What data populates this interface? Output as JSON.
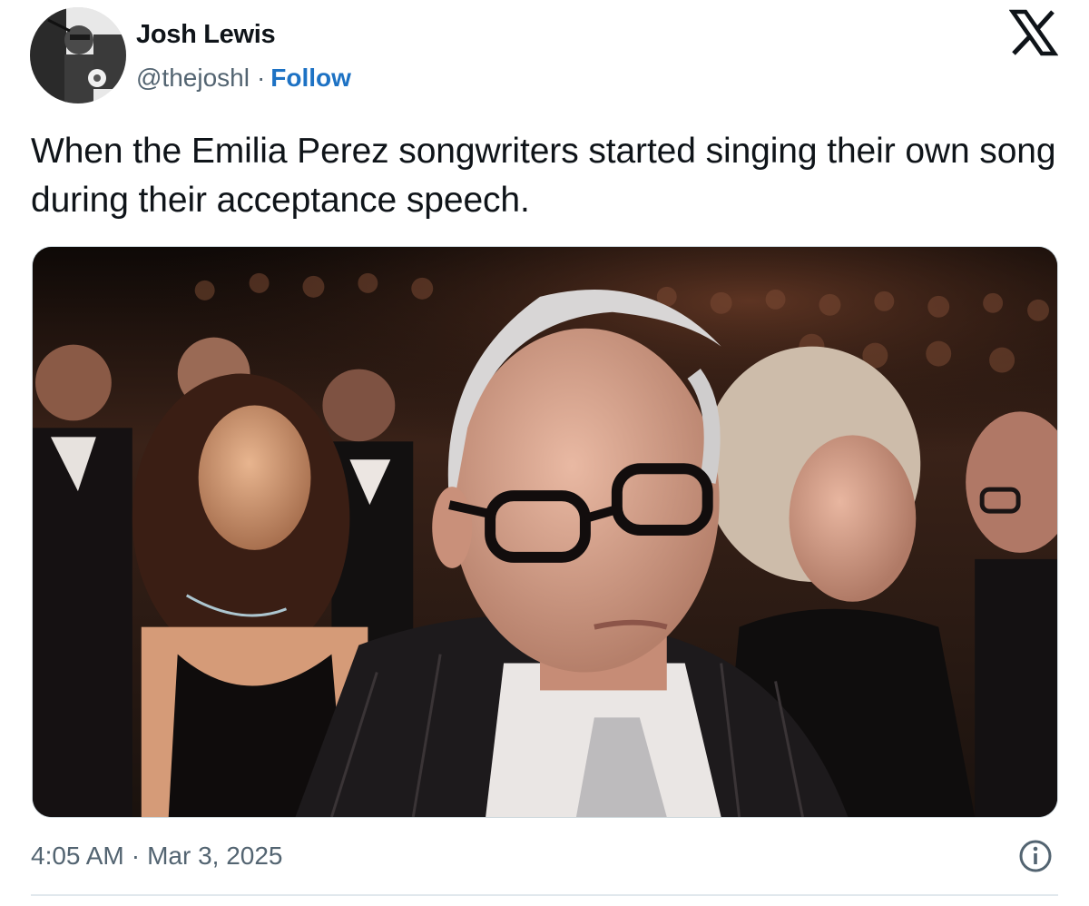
{
  "author": {
    "display_name": "Josh Lewis",
    "handle": "@thejoshl",
    "separator": "·",
    "follow_label": "Follow"
  },
  "platform": {
    "logo_icon": "x-logo-icon"
  },
  "tweet": {
    "text": "When the Emilia Perez songwriters started singing their own song during their acceptance speech."
  },
  "media": {
    "icon": "photo"
  },
  "footer": {
    "time": "4:05 AM",
    "separator": "·",
    "date": "Mar 3, 2025",
    "info_icon": "info-icon"
  },
  "colors": {
    "text": "#0f1419",
    "secondary": "#536471",
    "link": "#1d72c4",
    "divider": "#e1e8ed"
  }
}
